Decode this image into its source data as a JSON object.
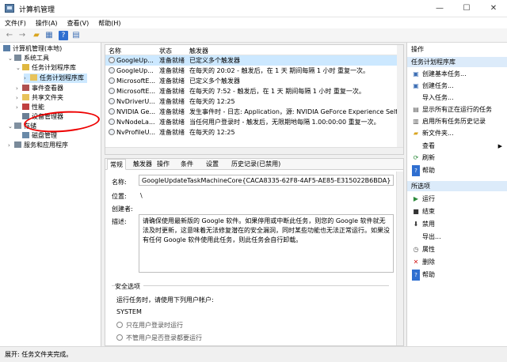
{
  "window": {
    "title": "计算机管理",
    "controls": [
      "—",
      "☐",
      "✕"
    ]
  },
  "menu": [
    "文件(F)",
    "操作(A)",
    "查看(V)",
    "帮助(H)"
  ],
  "toolbar": {
    "icons": [
      "back-icon",
      "forward-icon",
      "folder-up-icon",
      "show-hide-tree-icon",
      "help-icon",
      "properties-icon"
    ]
  },
  "tree": [
    {
      "label": "计算机管理(本地)",
      "level": 0,
      "expanded": true
    },
    {
      "label": "系统工具",
      "level": 1,
      "expanded": true
    },
    {
      "label": "任务计划程序库",
      "level": 2,
      "expanded": true
    },
    {
      "label": "任务计划程序库",
      "level": 3,
      "selected": true
    },
    {
      "label": "事件查看器",
      "level": 2
    },
    {
      "label": "共享文件夹",
      "level": 2
    },
    {
      "label": "性能",
      "level": 2
    },
    {
      "label": "设备管理器",
      "level": 2
    },
    {
      "label": "存储",
      "level": 1,
      "expanded": true
    },
    {
      "label": "磁盘管理",
      "level": 2
    },
    {
      "label": "服务和应用程序",
      "level": 1
    }
  ],
  "task_list": {
    "columns": [
      "名称",
      "状态",
      "触发器"
    ],
    "rows": [
      {
        "name": "GoogleUp...",
        "status": "准备就绪",
        "trigger": "已定义多个触发器",
        "selected": true
      },
      {
        "name": "GoogleUp...",
        "status": "准备就绪",
        "trigger": "在每天的 20:02 - 触发后，在 1 天 期间每隔 1 小时 重复一次。"
      },
      {
        "name": "MicrosoftE...",
        "status": "准备就绪",
        "trigger": "已定义多个触发器"
      },
      {
        "name": "MicrosoftE...",
        "status": "准备就绪",
        "trigger": "在每天的 7:52 - 触发后，在 1 天 期间每隔 1 小时 重复一次。"
      },
      {
        "name": "NvDriverU...",
        "status": "准备就绪",
        "trigger": "在每天的 12:25"
      },
      {
        "name": "NVIDIA Ge...",
        "status": "准备就绪",
        "trigger": "发生事件时 - 日志: Application，源: NVIDIA GeForce Experience SelfUp"
      },
      {
        "name": "NvNodeLa...",
        "status": "准备就绪",
        "trigger": "当任何用户登录时 - 触发后，无限期地每隔 1.00:00:00 重复一次。"
      },
      {
        "name": "NvProfileU...",
        "status": "准备就绪",
        "trigger": "在每天的 12:25"
      }
    ]
  },
  "detail": {
    "tabs": [
      "常规",
      "触发器",
      "操作",
      "条件",
      "设置",
      "历史记录(已禁用)"
    ],
    "name_label": "名称:",
    "name_value": "GoogleUpdateTaskMachineCore{CACA8335-62F8-4AF5-AE85-E315022B6BDA}",
    "location_label": "位置:",
    "location_value": "\\",
    "author_label": "创建者:",
    "author_value": "",
    "desc_label": "描述:",
    "desc_value": "请确保使用最新版的 Google 软件。如果停用或中断此任务，则您的 Google 软件就无法及时更新，这意味着无法修复潜在的安全漏洞，同时某些功能也无法正常运行。如果没有任何 Google 软件使用此任务，则此任务会自行卸载。",
    "security_title": "安全选项",
    "run_as_label": "运行任务时，请使用下列用户帐户:",
    "run_as_value": "SYSTEM",
    "radio_logged_on": "只在用户登录时运行",
    "radio_whether": "不管用户是否登录都要运行"
  },
  "actions": {
    "header": "操作",
    "section1_title": "任务计划程序库",
    "section1_items": [
      {
        "icon": "create-basic-task-icon",
        "label": "创建基本任务..."
      },
      {
        "icon": "create-task-icon",
        "label": "创建任务..."
      },
      {
        "icon": "import-task-icon",
        "label": "导入任务..."
      },
      {
        "icon": "show-running-icon",
        "label": "显示所有正在运行的任务"
      },
      {
        "icon": "enable-history-icon",
        "label": "启用所有任务历史记录"
      },
      {
        "icon": "new-folder-icon",
        "label": "新文件夹..."
      },
      {
        "icon": "view-icon",
        "label": "查看",
        "submenu": true
      },
      {
        "icon": "refresh-icon",
        "label": "刷新"
      },
      {
        "icon": "help-icon",
        "label": "帮助"
      }
    ],
    "section2_title": "所选项",
    "section2_items": [
      {
        "icon": "run-icon",
        "label": "运行"
      },
      {
        "icon": "end-icon",
        "label": "结束"
      },
      {
        "icon": "disable-icon",
        "label": "禁用"
      },
      {
        "icon": "export-icon",
        "label": "导出..."
      },
      {
        "icon": "properties-icon",
        "label": "属性"
      },
      {
        "icon": "delete-icon",
        "label": "删除"
      },
      {
        "icon": "help-icon",
        "label": "帮助"
      }
    ]
  },
  "status_bar": "展开: 任务文件夹完成。",
  "colors": {
    "selection": "#cce8ff",
    "section_header": "#dcebfa",
    "annotation": "#e00000"
  }
}
